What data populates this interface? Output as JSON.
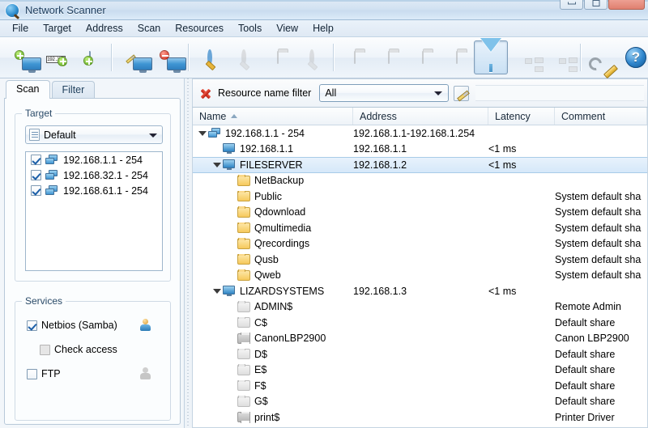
{
  "window": {
    "title": "Network Scanner",
    "app_icon": "magnifier-globe-icon",
    "controls": {
      "minimize": "minimize-button",
      "maximize": "maximize-button",
      "close": "close-button"
    }
  },
  "menu": {
    "items": [
      "File",
      "Target",
      "Address",
      "Scan",
      "Resources",
      "Tools",
      "View",
      "Help"
    ]
  },
  "toolbar": {
    "buttons": [
      {
        "name": "add-computer-button",
        "icon": "monitor-add-icon",
        "enabled": true,
        "active": false
      },
      {
        "name": "add-ip-range-button",
        "icon": "ip-range-add-icon",
        "enabled": true,
        "active": false
      },
      {
        "name": "add-from-file-button",
        "icon": "document-add-icon",
        "enabled": true,
        "active": false
      },
      {
        "name": "edit-target-button",
        "icon": "monitor-edit-icon",
        "enabled": true,
        "active": false
      },
      {
        "name": "remove-target-button",
        "icon": "monitor-remove-icon",
        "enabled": true,
        "active": false
      },
      {
        "name": "start-scan-button",
        "icon": "magnifier-start-icon",
        "enabled": true,
        "active": false
      },
      {
        "name": "pause-scan-button",
        "icon": "magnifier-pause-icon",
        "enabled": false,
        "active": false
      },
      {
        "name": "scan-folder-button",
        "icon": "folder-scan-icon",
        "enabled": false,
        "active": false
      },
      {
        "name": "stop-scan-button",
        "icon": "magnifier-stop-icon",
        "enabled": false,
        "active": false
      },
      {
        "name": "resource-open-button",
        "icon": "folder-open-icon",
        "enabled": false,
        "active": false
      },
      {
        "name": "resource-edit-button",
        "icon": "folder-edit-icon",
        "enabled": false,
        "active": false
      },
      {
        "name": "resource-remove-button",
        "icon": "folder-remove-icon",
        "enabled": false,
        "active": false
      },
      {
        "name": "resource-map-button",
        "icon": "folder-map-icon",
        "enabled": false,
        "active": false
      },
      {
        "name": "filter-button",
        "icon": "funnel-filter-icon",
        "enabled": true,
        "active": true
      },
      {
        "name": "expand-tree-button",
        "icon": "tree-expand-icon",
        "enabled": false,
        "active": false
      },
      {
        "name": "collapse-tree-button",
        "icon": "tree-collapse-icon",
        "enabled": false,
        "active": false
      },
      {
        "name": "options-button",
        "icon": "wrench-icon",
        "enabled": true,
        "active": false
      },
      {
        "name": "help-button",
        "icon": "help-question-icon",
        "enabled": true,
        "active": false
      }
    ],
    "separators_after": [
      2,
      4,
      8,
      15
    ]
  },
  "sidebar": {
    "tabs": [
      {
        "label": "Scan",
        "selected": true
      },
      {
        "label": "Filter",
        "selected": false
      }
    ],
    "target_group": {
      "label": "Target",
      "profile_combo": {
        "value": "Default",
        "icon": "list-profile-icon"
      },
      "items": [
        {
          "label": "192.168.1.1 - 254",
          "checked": true,
          "icon": "network-icon"
        },
        {
          "label": "192.168.32.1 - 254",
          "checked": true,
          "icon": "network-icon"
        },
        {
          "label": "192.168.61.1 - 254",
          "checked": true,
          "icon": "network-icon"
        }
      ]
    },
    "services_group": {
      "label": "Services",
      "items": [
        {
          "label": "Netbios (Samba)",
          "checked": true,
          "enabled": true,
          "indent": 0,
          "icon": "user-colored-icon"
        },
        {
          "label": "Check access",
          "checked": false,
          "enabled": false,
          "indent": 1,
          "icon": ""
        },
        {
          "label": "FTP",
          "checked": false,
          "enabled": true,
          "indent": 0,
          "icon": "user-grey-icon"
        }
      ]
    }
  },
  "main": {
    "filter_bar": {
      "clear_icon": "red-x-icon",
      "label": "Resource name filter",
      "combo_value": "All",
      "edit_icon": "edit-filter-icon"
    },
    "columns": [
      {
        "key": "name",
        "label": "Name",
        "width": 198,
        "sorted": "asc"
      },
      {
        "key": "address",
        "label": "Address",
        "width": 167,
        "sorted": ""
      },
      {
        "key": "latency",
        "label": "Latency",
        "width": 82,
        "sorted": ""
      },
      {
        "key": "comment",
        "label": "Comment",
        "width": 114,
        "sorted": ""
      }
    ],
    "rows": [
      {
        "name": "192.168.1.1 - 254",
        "address": "192.168.1.1-192.168.1.254",
        "latency": "",
        "comment": "",
        "indent": 0,
        "icon": "network-icon",
        "expander": "open",
        "selected": false
      },
      {
        "name": "192.168.1.1",
        "address": "192.168.1.1",
        "latency": "<1 ms",
        "comment": "",
        "indent": 1,
        "icon": "computer-icon",
        "expander": "none",
        "selected": false
      },
      {
        "name": "FILESERVER",
        "address": "192.168.1.2",
        "latency": "<1 ms",
        "comment": "",
        "indent": 1,
        "icon": "computer-icon",
        "expander": "open",
        "selected": true
      },
      {
        "name": "NetBackup",
        "address": "",
        "latency": "",
        "comment": "",
        "indent": 2,
        "icon": "folder-icon",
        "expander": "none",
        "selected": false
      },
      {
        "name": "Public",
        "address": "",
        "latency": "",
        "comment": "System default sha",
        "indent": 2,
        "icon": "folder-icon",
        "expander": "none",
        "selected": false
      },
      {
        "name": "Qdownload",
        "address": "",
        "latency": "",
        "comment": "System default sha",
        "indent": 2,
        "icon": "folder-icon",
        "expander": "none",
        "selected": false
      },
      {
        "name": "Qmultimedia",
        "address": "",
        "latency": "",
        "comment": "System default sha",
        "indent": 2,
        "icon": "folder-icon",
        "expander": "none",
        "selected": false
      },
      {
        "name": "Qrecordings",
        "address": "",
        "latency": "",
        "comment": "System default sha",
        "indent": 2,
        "icon": "folder-icon",
        "expander": "none",
        "selected": false
      },
      {
        "name": "Qusb",
        "address": "",
        "latency": "",
        "comment": "System default sha",
        "indent": 2,
        "icon": "folder-icon",
        "expander": "none",
        "selected": false
      },
      {
        "name": "Qweb",
        "address": "",
        "latency": "",
        "comment": "System default sha",
        "indent": 2,
        "icon": "folder-icon",
        "expander": "none",
        "selected": false
      },
      {
        "name": "LIZARDSYSTEMS",
        "address": "192.168.1.3",
        "latency": "<1 ms",
        "comment": "",
        "indent": 1,
        "icon": "computer-icon",
        "expander": "open",
        "selected": false
      },
      {
        "name": "ADMIN$",
        "address": "",
        "latency": "",
        "comment": "Remote Admin",
        "indent": 2,
        "icon": "folder-grey-icon",
        "expander": "none",
        "selected": false
      },
      {
        "name": "C$",
        "address": "",
        "latency": "",
        "comment": "Default share",
        "indent": 2,
        "icon": "folder-grey-icon",
        "expander": "none",
        "selected": false
      },
      {
        "name": "CanonLBP2900",
        "address": "",
        "latency": "",
        "comment": "Canon LBP2900",
        "indent": 2,
        "icon": "printer-icon",
        "expander": "none",
        "selected": false
      },
      {
        "name": "D$",
        "address": "",
        "latency": "",
        "comment": "Default share",
        "indent": 2,
        "icon": "folder-grey-icon",
        "expander": "none",
        "selected": false
      },
      {
        "name": "E$",
        "address": "",
        "latency": "",
        "comment": "Default share",
        "indent": 2,
        "icon": "folder-grey-icon",
        "expander": "none",
        "selected": false
      },
      {
        "name": "F$",
        "address": "",
        "latency": "",
        "comment": "Default share",
        "indent": 2,
        "icon": "folder-grey-icon",
        "expander": "none",
        "selected": false
      },
      {
        "name": "G$",
        "address": "",
        "latency": "",
        "comment": "Default share",
        "indent": 2,
        "icon": "folder-grey-icon",
        "expander": "none",
        "selected": false
      },
      {
        "name": "print$",
        "address": "",
        "latency": "",
        "comment": "Printer Driver",
        "indent": 2,
        "icon": "printer-icon",
        "expander": "none",
        "selected": false
      }
    ]
  },
  "colors": {
    "selection": "#d6e8f9",
    "accent": "#3f95d3",
    "folder": "#f6c95c",
    "clear_x": "#b81d10"
  }
}
